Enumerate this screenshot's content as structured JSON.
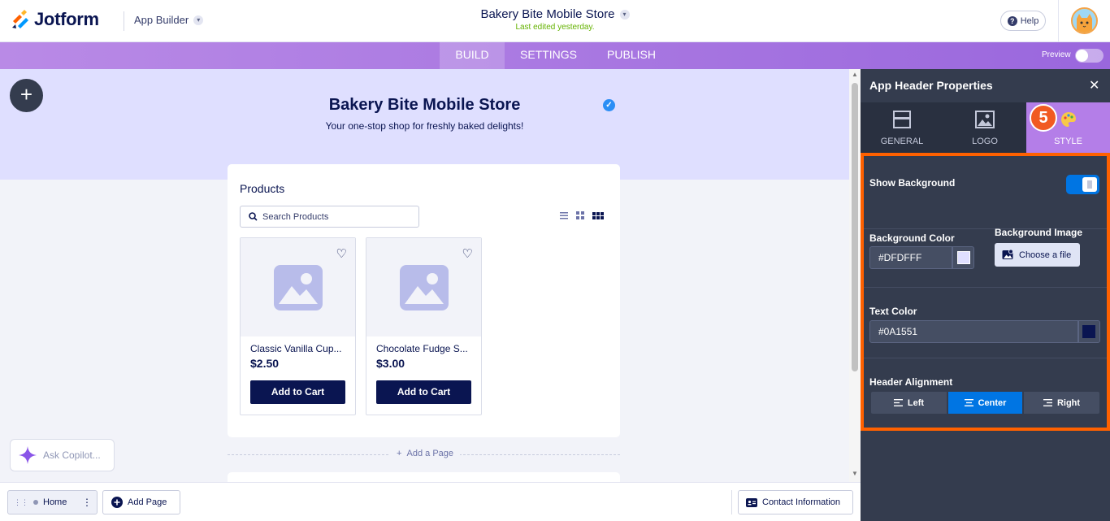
{
  "topbar": {
    "logo_text": "Jotform",
    "app_builder_label": "App Builder",
    "app_title": "Bakery Bite Mobile Store",
    "last_edited": "Last edited yesterday.",
    "help_label": "Help"
  },
  "nav": {
    "tabs": [
      {
        "label": "BUILD",
        "active": true
      },
      {
        "label": "SETTINGS",
        "active": false
      },
      {
        "label": "PUBLISH",
        "active": false
      }
    ],
    "preview_label": "Preview",
    "preview_on": false
  },
  "canvas": {
    "header_title": "Bakery Bite Mobile Store",
    "header_subtitle": "Your one-stop shop for freshly baked delights!",
    "products_heading": "Products",
    "search_placeholder": "Search Products",
    "products": [
      {
        "name": "Classic Vanilla Cup...",
        "price": "$2.50",
        "button": "Add to Cart"
      },
      {
        "name": "Chocolate Fudge S...",
        "price": "$3.00",
        "button": "Add to Cart"
      }
    ],
    "add_page_label": "Add a Page",
    "copilot_placeholder": "Ask Copilot..."
  },
  "bottombar": {
    "home_label": "Home",
    "add_page_label": "Add Page",
    "contact_label": "Contact Information"
  },
  "panel": {
    "title": "App Header Properties",
    "tabs": [
      {
        "label": "GENERAL",
        "icon": "layout-icon",
        "active": false
      },
      {
        "label": "LOGO",
        "icon": "image-icon",
        "active": false
      },
      {
        "label": "STYLE",
        "icon": "palette-icon",
        "active": true
      }
    ],
    "step_badge": "5",
    "show_background_label": "Show Background",
    "show_background_on": true,
    "background_color_label": "Background Color",
    "background_color_value": "#DFDFFF",
    "background_image_label": "Background Image",
    "choose_file_label": "Choose a file",
    "text_color_label": "Text Color",
    "text_color_value": "#0A1551",
    "header_alignment_label": "Header Alignment",
    "alignment_options": [
      {
        "label": "Left",
        "active": false
      },
      {
        "label": "Center",
        "active": true
      },
      {
        "label": "Right",
        "active": false
      }
    ]
  },
  "colors": {
    "navy": "#0A1551",
    "header_bg": "#DFDFFF",
    "accent_purple": "#B47EE8",
    "highlight_orange": "#FF6100",
    "active_blue": "#0075E3"
  }
}
